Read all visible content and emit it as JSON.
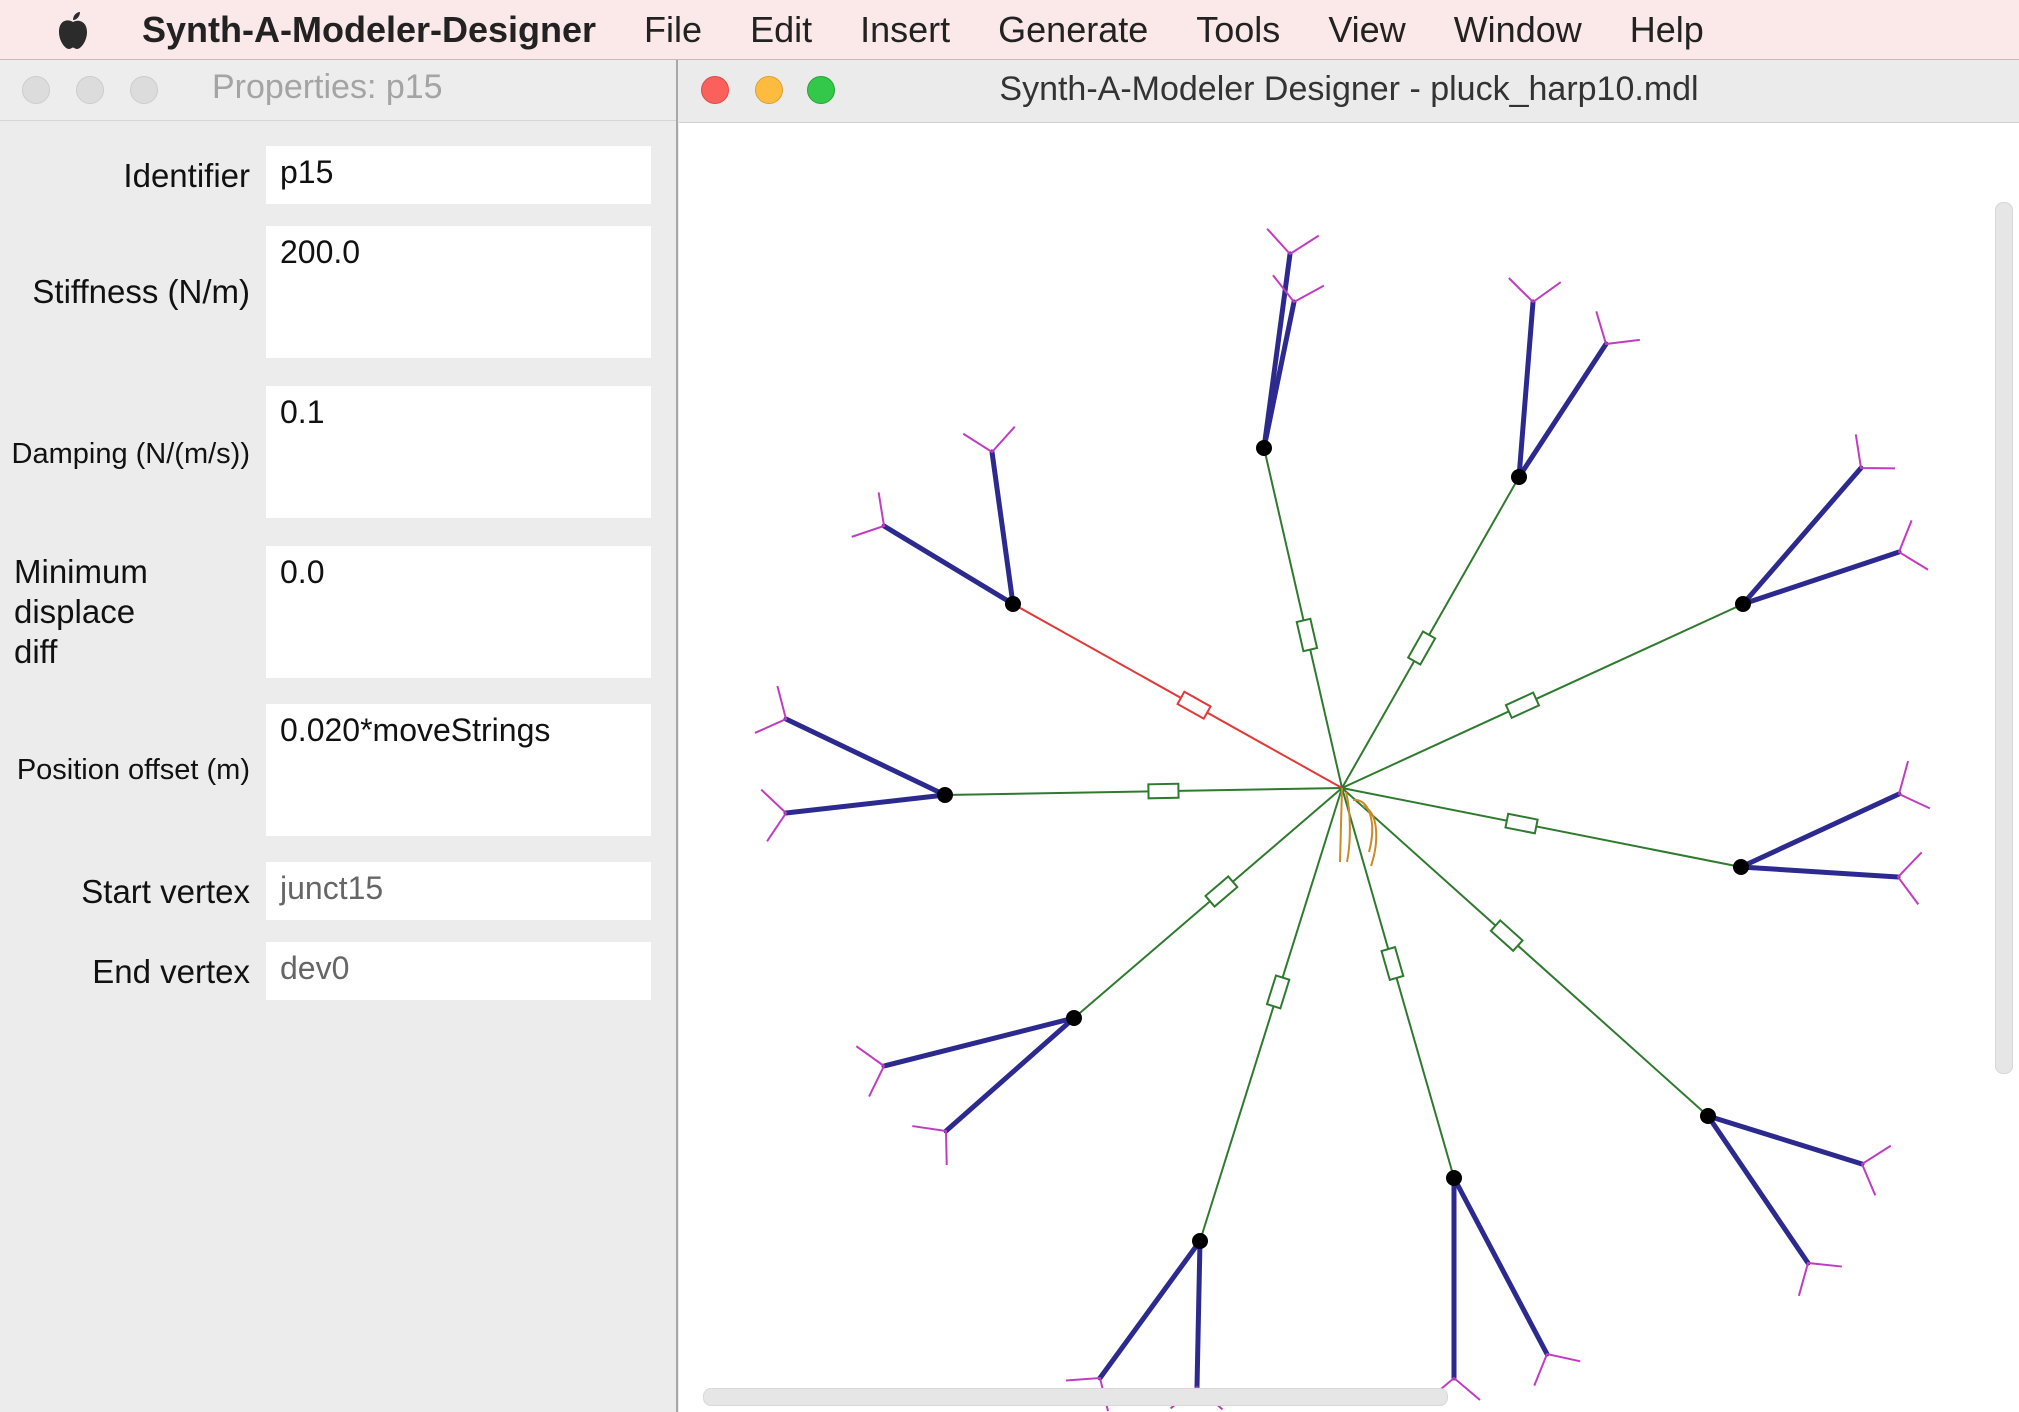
{
  "menubar": {
    "apple_icon": "apple-icon",
    "app_name": "Synth-A-Modeler-Designer",
    "items": [
      "File",
      "Edit",
      "Insert",
      "Generate",
      "Tools",
      "View",
      "Window",
      "Help"
    ]
  },
  "properties_window": {
    "title": "Properties: p15",
    "fields": {
      "identifier": {
        "label": "Identifier",
        "value": "p15"
      },
      "stiffness": {
        "label": "Stiffness (N/m)",
        "value": "200.0"
      },
      "damping": {
        "label": "Damping (N/(m/s))",
        "value": "0.1"
      },
      "minimum_displace_diff": {
        "label_lines": [
          "Minimum",
          "displace",
          "diff"
        ],
        "value": "0.0"
      },
      "position_offset": {
        "label": "Position offset (m)",
        "value": "0.020*moveStrings"
      },
      "start_vertex": {
        "label": "Start vertex",
        "value": "junct15"
      },
      "end_vertex": {
        "label": "End vertex",
        "value": "dev0"
      }
    }
  },
  "designer_window": {
    "title": "Synth-A-Modeler Designer - pluck_harp10.mdl"
  },
  "colors": {
    "menubar_bg": "#fbe9ea",
    "link_green": "#2f7a2f",
    "selected_link_red": "#e03a3a",
    "string_blue": "#2c2a8f",
    "ground_magenta": "#c23cc2",
    "node_black": "#000000",
    "device_orange": "#c98a2a"
  }
}
